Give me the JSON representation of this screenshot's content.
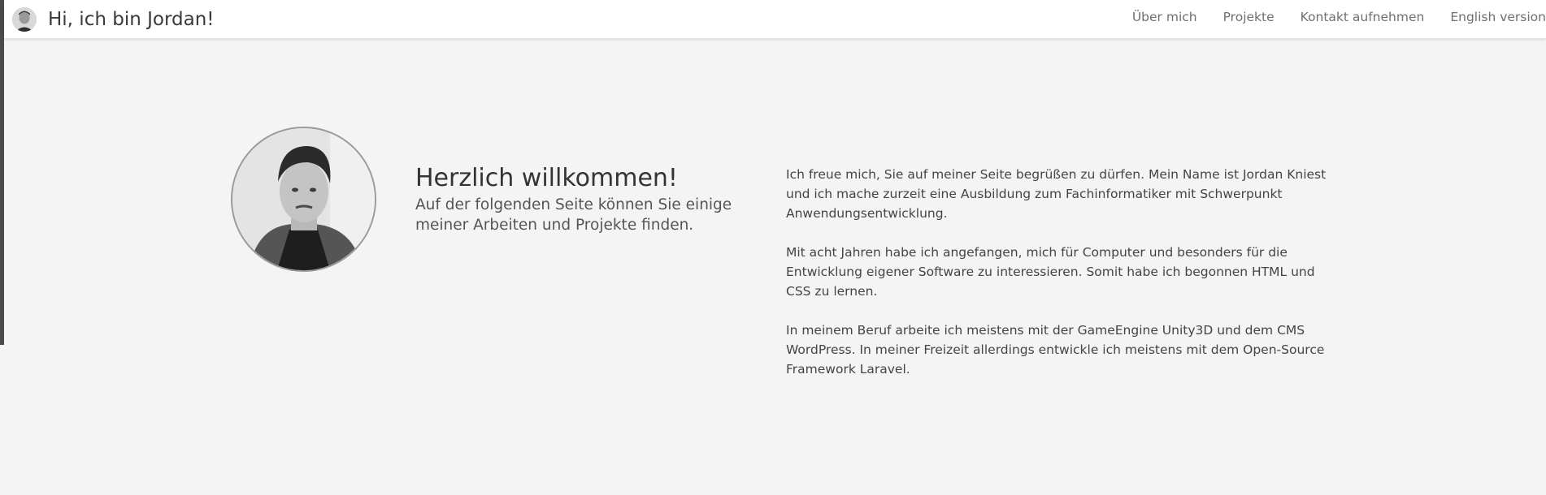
{
  "header": {
    "title": "Hi, ich bin Jordan!",
    "avatar_icon": "user-avatar",
    "nav": [
      {
        "label": "Über mich"
      },
      {
        "label": "Projekte"
      },
      {
        "label": "Kontakt aufnehmen"
      },
      {
        "label": "English version"
      }
    ]
  },
  "hero": {
    "portrait_icon": "portrait-photo",
    "title": "Herzlich willkommen!",
    "subtitle": "Auf der folgenden Seite können Sie einige meiner Arbeiten und Projekte finden."
  },
  "about": {
    "paragraphs": [
      "Ich freue mich, Sie auf meiner Seite begrüßen zu dürfen. Mein Name ist Jordan Kniest und ich mache zurzeit eine Ausbildung zum Fachinformatiker mit Schwerpunkt Anwendungsentwicklung.",
      "Mit acht Jahren habe ich angefangen, mich für Computer und besonders für die Entwicklung eigener Software zu interessieren. Somit habe ich begonnen HTML und CSS zu lernen.",
      "In meinem Beruf arbeite ich meistens mit der GameEngine Unity3D und dem CMS WordPress. In meiner Freizeit allerdings entwickle ich meistens mit dem Open-Source Framework Laravel."
    ]
  },
  "colors": {
    "background": "#f4f4f4",
    "navbar": "#ffffff",
    "text": "#333333",
    "nav_link": "#6f6f6f"
  }
}
